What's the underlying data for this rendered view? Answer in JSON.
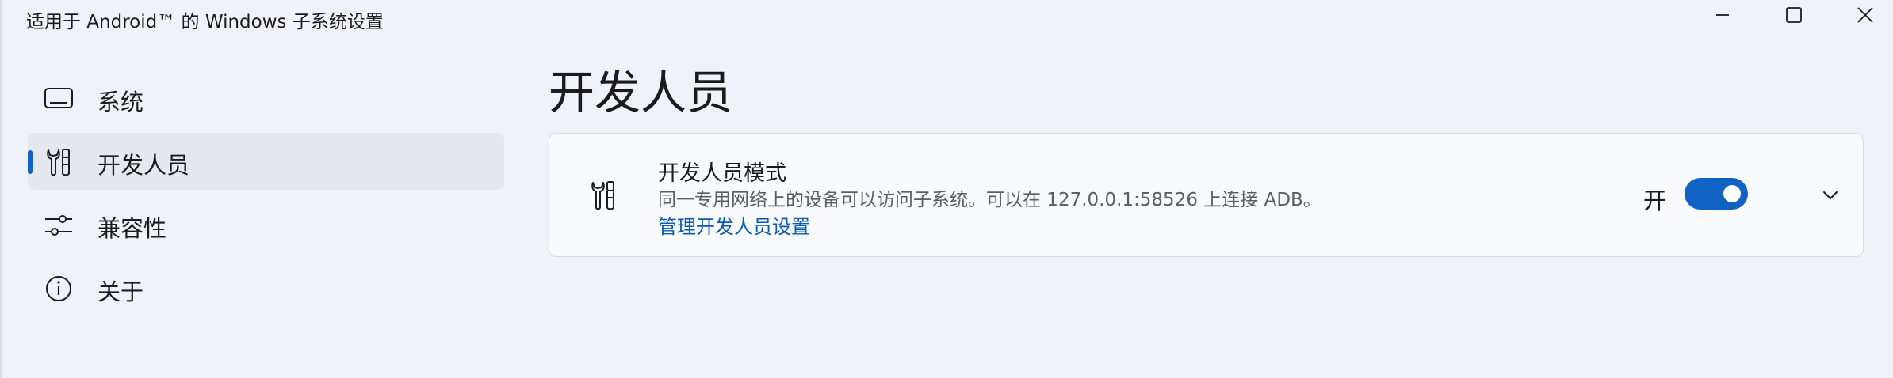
{
  "window": {
    "title": "适用于 Android™ 的 Windows 子系统设置",
    "minimize_icon": "minimize-icon",
    "maximize_icon": "maximize-icon",
    "close_icon": "close-icon"
  },
  "sidebar": {
    "items": [
      {
        "label": "系统",
        "icon": "monitor-icon",
        "selected": false
      },
      {
        "label": "开发人员",
        "icon": "developer-tools-icon",
        "selected": true
      },
      {
        "label": "兼容性",
        "icon": "sliders-icon",
        "selected": false
      },
      {
        "label": "关于",
        "icon": "info-icon",
        "selected": false
      }
    ]
  },
  "main": {
    "page_title": "开发人员",
    "developer_mode": {
      "icon": "developer-tools-icon",
      "title": "开发人员模式",
      "description": "同一专用网络上的设备可以访问子系统。可以在 127.0.0.1:58526 上连接 ADB。",
      "link": "管理开发人员设置",
      "toggle_label": "开",
      "toggle_on": true,
      "expand_icon": "chevron-down-icon"
    }
  },
  "colors": {
    "accent": "#0f63c3",
    "link": "#0a59b2",
    "background": "#eff3f9",
    "card": "#f8fafd"
  }
}
